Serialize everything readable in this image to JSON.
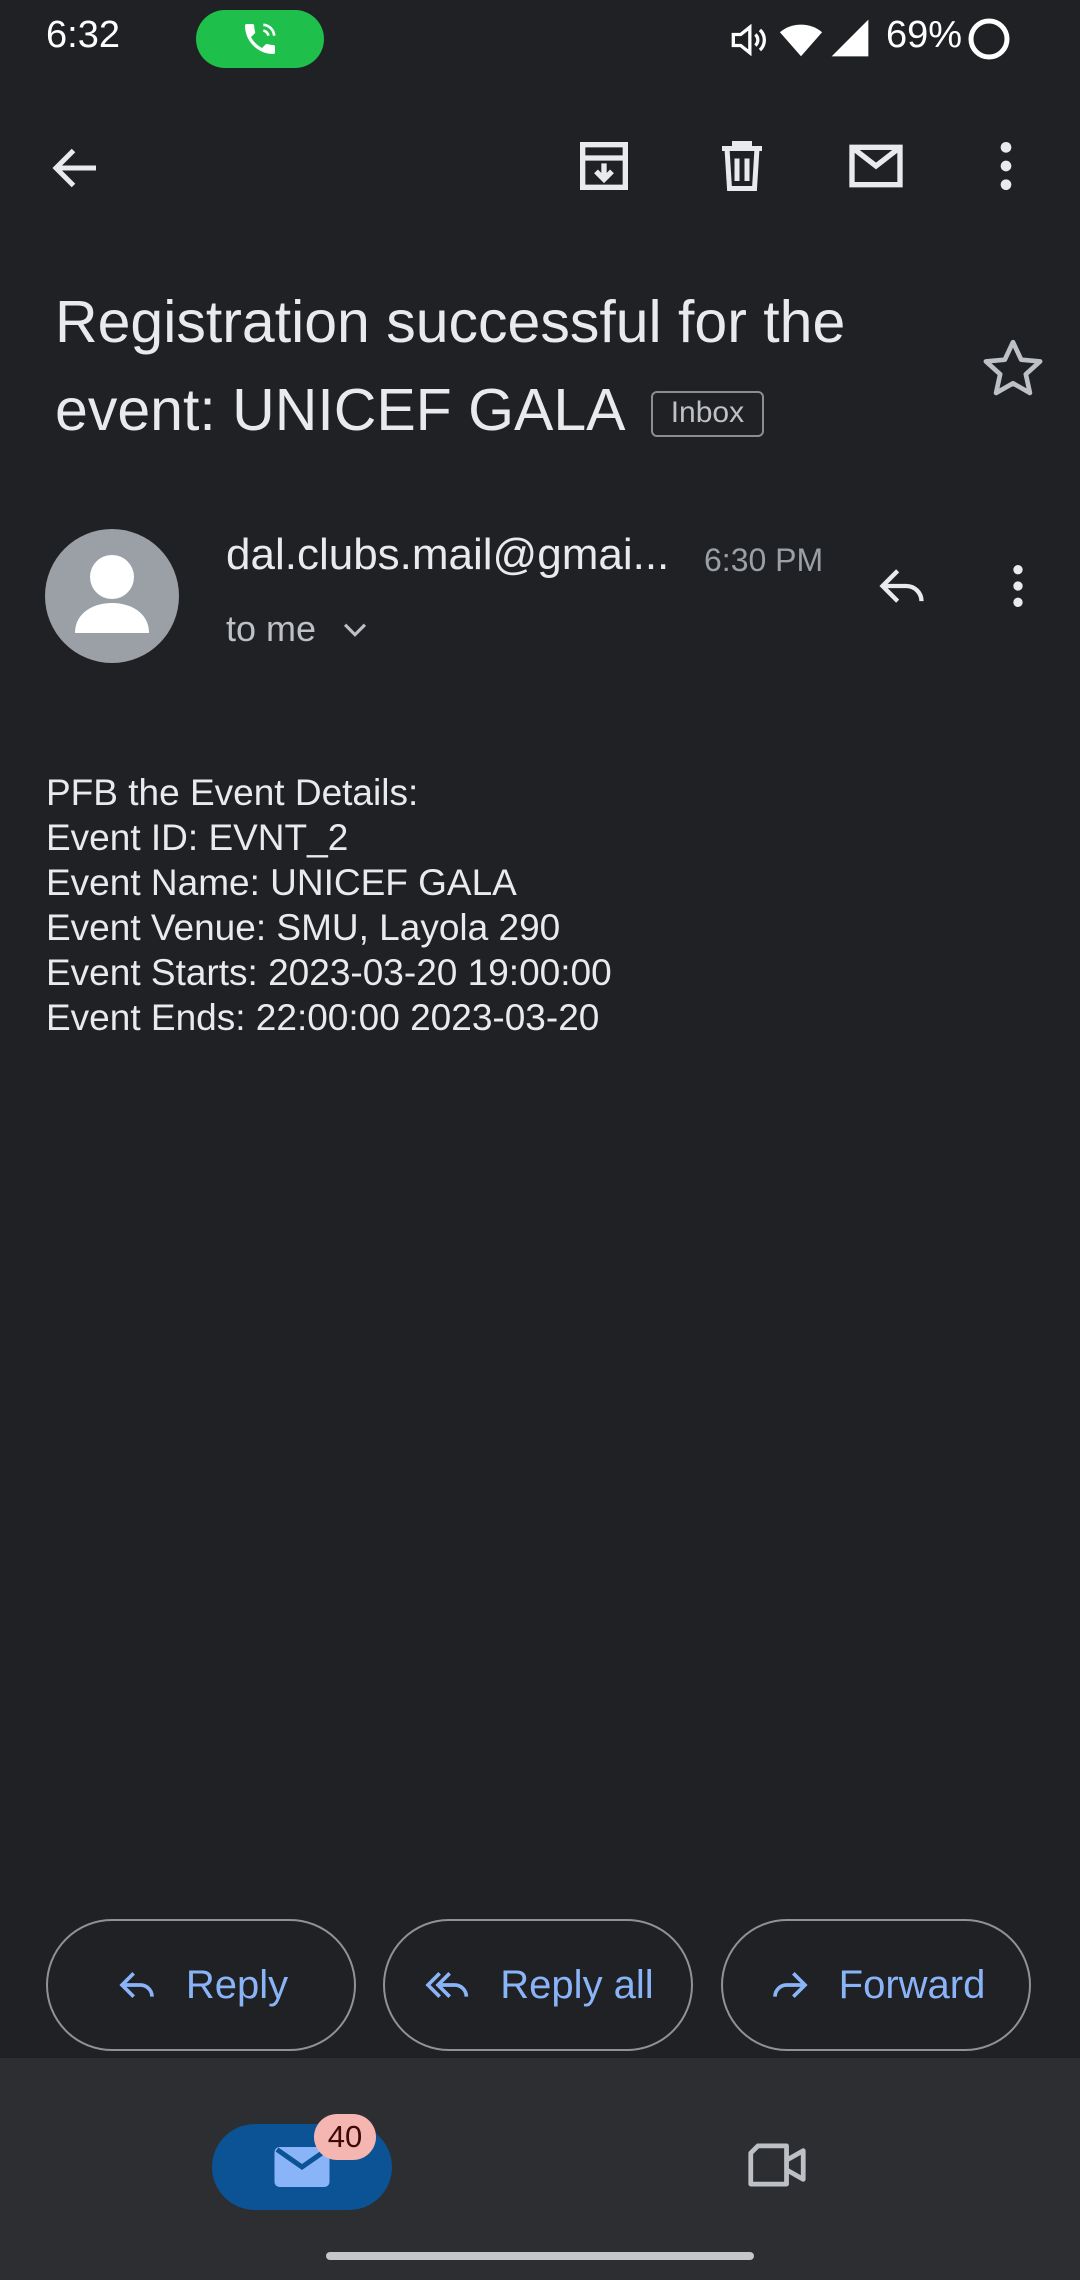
{
  "status_bar": {
    "time": "6:32",
    "battery": "69%",
    "icons": [
      "phone-call-icon",
      "volume-icon",
      "wifi-icon",
      "signal-icon",
      "battery-icon"
    ]
  },
  "toolbar": {
    "icons": [
      "back-arrow-icon",
      "archive-icon",
      "delete-icon",
      "mark-unread-icon",
      "more-vert-icon"
    ]
  },
  "email": {
    "subject": "Registration successful for the event: UNICEF GALA",
    "label": "Inbox",
    "sender": "dal.clubs.mail@gmai...",
    "time": "6:30 PM",
    "recipient": "to me",
    "body": [
      "PFB the Event Details:",
      "Event ID: EVNT_2",
      "Event Name: UNICEF GALA",
      "Event Venue: SMU, Layola 290",
      "Event Starts: 2023-03-20 19:00:00",
      "Event Ends: 22:00:00 2023-03-20"
    ]
  },
  "actions": {
    "reply": "Reply",
    "reply_all": "Reply all",
    "forward": "Forward"
  },
  "bottom_nav": {
    "mail_badge": "40",
    "icons": [
      "mail-icon",
      "video-icon"
    ]
  },
  "colors": {
    "background": "#202124",
    "accent": "#8ab4f8",
    "call_green": "#1fbf4c",
    "mail_tab": "#0b5394",
    "badge": "#f5b5b0"
  }
}
